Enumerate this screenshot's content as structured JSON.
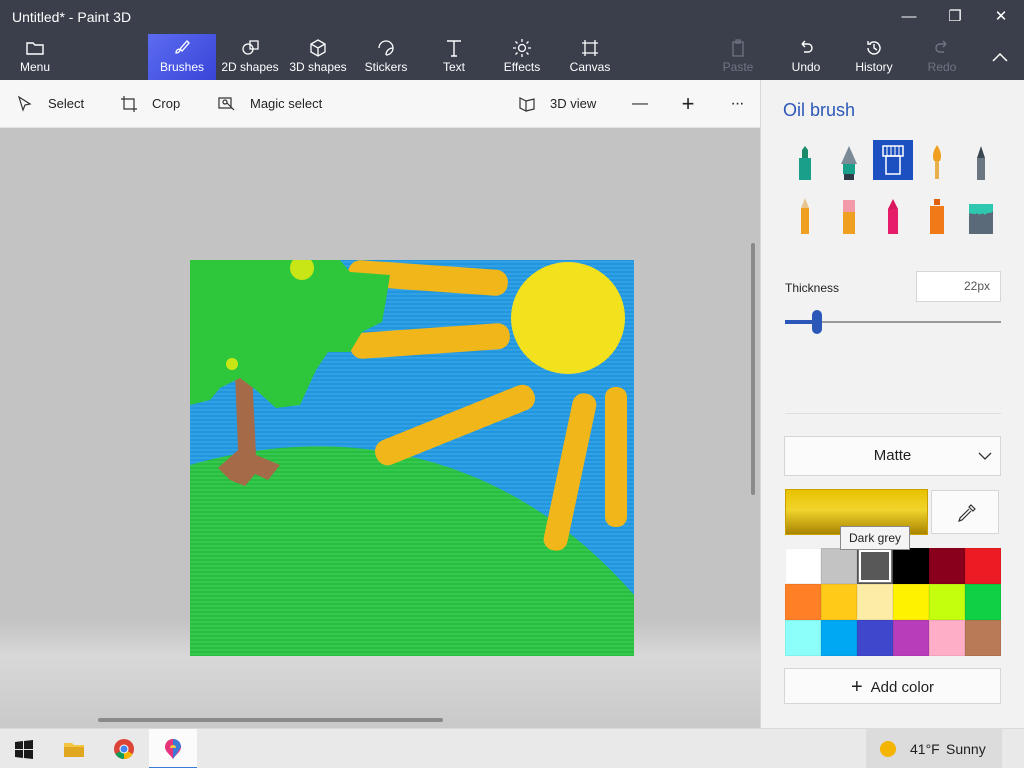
{
  "window": {
    "title": "Untitled* - Paint 3D",
    "minimize_glyph": "—",
    "restore_glyph": "❐",
    "close_glyph": "✕"
  },
  "ribbon": {
    "menu": "Menu",
    "brushes": "Brushes",
    "shapes_2d": "2D shapes",
    "shapes_3d": "3D shapes",
    "stickers": "Stickers",
    "text": "Text",
    "effects": "Effects",
    "canvas": "Canvas",
    "paste": "Paste",
    "undo": "Undo",
    "history": "History",
    "redo": "Redo",
    "active_tool": "Brushes"
  },
  "toolbar": {
    "select": "Select",
    "crop": "Crop",
    "magic_select": "Magic select",
    "view_3d": "3D view",
    "zoom_out": "—",
    "zoom_in": "+",
    "more": "···"
  },
  "panel": {
    "title": "Oil brush",
    "brushes": [
      {
        "name": "marker",
        "selected": false
      },
      {
        "name": "calligraphy-pen",
        "selected": false
      },
      {
        "name": "oil-brush",
        "selected": true
      },
      {
        "name": "watercolor",
        "selected": false
      },
      {
        "name": "pixel-pen",
        "selected": false
      },
      {
        "name": "pencil",
        "selected": false
      },
      {
        "name": "eraser",
        "selected": false
      },
      {
        "name": "crayon",
        "selected": false
      },
      {
        "name": "spray-can",
        "selected": false
      },
      {
        "name": "fill",
        "selected": false
      }
    ],
    "thickness_label": "Thickness",
    "thickness_value": "22px",
    "thickness_fraction": 0.15,
    "finish": "Matte",
    "current_color": "#e8c200",
    "tooltip": "Dark grey",
    "add_color": "Add color",
    "swatches": [
      "#ffffff",
      "#c3c3c3",
      "#585858",
      "#000000",
      "#88001b",
      "#ec1c24",
      "#ff7f27",
      "#ffca18",
      "#fdeca6",
      "#fff200",
      "#c4ff0e",
      "#0ed145",
      "#8cfffb",
      "#00a8f3",
      "#3f48cc",
      "#b83dba",
      "#ffaec8",
      "#b97a57"
    ],
    "selected_swatch": 2
  },
  "taskbar": {
    "items": [
      "windows-start",
      "file-explorer",
      "chrome",
      "paint-3d"
    ],
    "active": "paint-3d",
    "weather_temp": "41°F",
    "weather_cond": "Sunny"
  },
  "colors": {
    "chrome_bg": "#3a3f4b",
    "accent": "#2b58b8",
    "active_tool": "#4b5ae6"
  }
}
